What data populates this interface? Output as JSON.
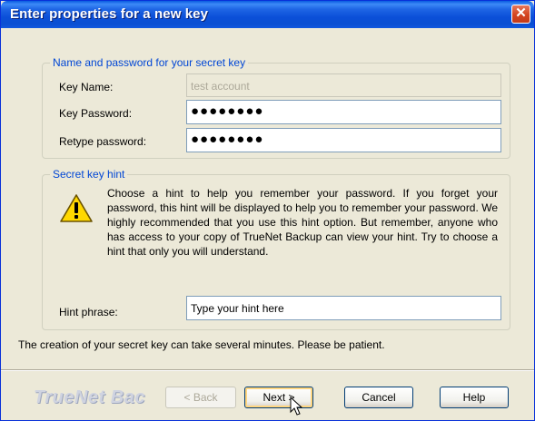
{
  "window": {
    "title": "Enter properties for a new key",
    "close_glyph": "✕"
  },
  "credentials": {
    "legend": "Name and password for your secret key",
    "key_name_label": "Key Name:",
    "key_name_value": "test account",
    "key_password_label": "Key Password:",
    "key_password_value": "●●●●●●●●",
    "retype_label": "Retype password:",
    "retype_value": "●●●●●●●●"
  },
  "hint": {
    "legend": "Secret key hint",
    "icon": "warning-icon",
    "text": "Choose a hint to help you remember your password. If you forget your password, this hint will be displayed to help you to remember your password. We highly recommended that you use this hint option. But remember, anyone who has access to your copy of TrueNet Backup can view your hint. Try to choose a hint that only you will understand.",
    "phrase_label": "Hint phrase:",
    "phrase_value": "Type your hint here"
  },
  "note": "The creation of your secret key can take several minutes. Please be patient.",
  "footer": {
    "brand": "TrueNet Bac",
    "back_label": "< Back",
    "next_label": "Next >",
    "cancel_label": "Cancel",
    "help_label": "Help"
  },
  "colors": {
    "title_bar": "#0a4fd2",
    "legend_text": "#0046d5",
    "dialog_bg": "#ece9d8",
    "close_button": "#d4431f"
  }
}
